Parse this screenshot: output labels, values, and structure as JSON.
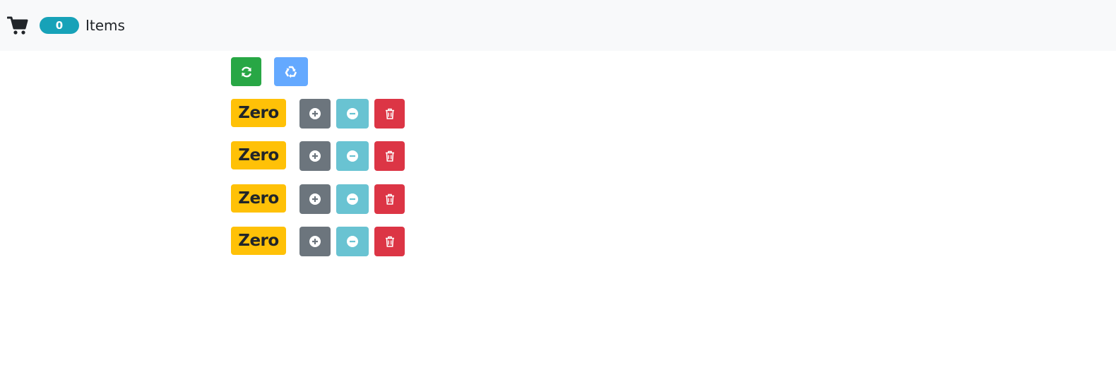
{
  "navbar": {
    "cart_icon": "shopping-cart-icon",
    "item_count": "0",
    "items_label": "Items"
  },
  "toolbar": {
    "refresh_icon": "refresh-icon",
    "recycle_icon": "recycle-icon"
  },
  "counters": [
    {
      "label": "Zero"
    },
    {
      "label": "Zero"
    },
    {
      "label": "Zero"
    },
    {
      "label": "Zero"
    }
  ],
  "colors": {
    "navbar_bg": "#f8f9fa",
    "badge_info": "#17a2b8",
    "success": "#28a745",
    "primary_light": "#64a9ff",
    "warning": "#ffc107",
    "secondary": "#6c757d",
    "info_light": "#69c3d2",
    "danger": "#dc3545"
  }
}
